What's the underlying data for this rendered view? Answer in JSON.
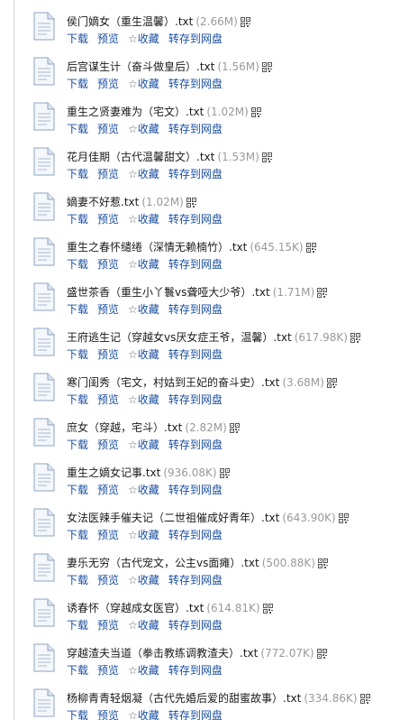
{
  "actions": {
    "download": "下载",
    "preview": "预览",
    "favorite": "收藏",
    "favorite_icon": "☆",
    "save_to_disk": "转存到网盘"
  },
  "icons": {
    "file": "txt-document-icon",
    "qr": "qr-code-icon"
  },
  "files": [
    {
      "name": "侯门嫡女（重生温馨）.txt",
      "size": "(2.66M)"
    },
    {
      "name": "后宫谋生计（奋斗做皇后）.txt",
      "size": "(1.56M)"
    },
    {
      "name": "重生之贤妻难为（宅文）.txt",
      "size": "(1.02M)"
    },
    {
      "name": "花月佳期（古代温馨甜文）.txt",
      "size": "(1.53M)"
    },
    {
      "name": "嫡妻不好惹.txt",
      "size": "(1.02M)"
    },
    {
      "name": "重生之春怀缱绻（深情无赖楠竹）.txt",
      "size": "(645.15K)"
    },
    {
      "name": "盛世茶香（重生小丫鬟vs聋哑大少爷）.txt",
      "size": "(1.71M)"
    },
    {
      "name": "王府逃生记（穿越女vs厌女症王爷，温馨）.txt",
      "size": "(617.98K)"
    },
    {
      "name": "寒门闺秀（宅文，村姑到王妃的奋斗史）.txt",
      "size": "(3.68M)"
    },
    {
      "name": "庶女（穿越，宅斗）.txt",
      "size": "(2.82M)"
    },
    {
      "name": "重生之嫡女记事.txt",
      "size": "(936.08K)"
    },
    {
      "name": "女法医辣手催夫记（二世祖催成好青年）.txt",
      "size": "(643.90K)"
    },
    {
      "name": "妻乐无穷（古代宠文，公主vs面瘫）.txt",
      "size": "(500.88K)"
    },
    {
      "name": "诱春怀（穿越成女医官）.txt",
      "size": "(614.81K)"
    },
    {
      "name": "穿越渣夫当道（拳击教练调教渣夫）.txt",
      "size": "(772.07K)"
    },
    {
      "name": "杨柳青青轻烟凝（古代先婚后爱的甜蜜故事）.txt",
      "size": "(334.86K)"
    }
  ]
}
